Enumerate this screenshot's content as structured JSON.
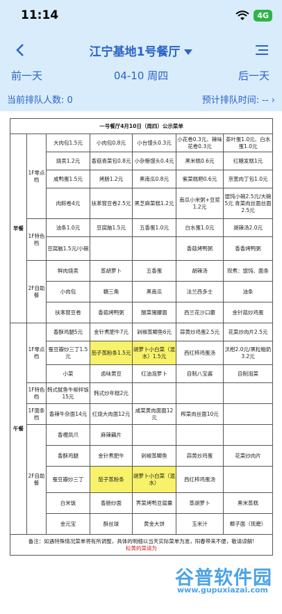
{
  "status": {
    "time": "11:14",
    "network": "4G"
  },
  "nav": {
    "title": "江宁基地1号餐厅"
  },
  "dates": {
    "prev": "前一天",
    "current": "04-10 周四",
    "next": "后一天"
  },
  "queue": {
    "current_label": "当前排队人数: 0",
    "expected_label": "预计排队时间: --"
  },
  "menu": {
    "title": "一号餐厅4月10日（周四）公示菜单",
    "breakfast": {
      "label": "早餐",
      "snack_label": "1F零点档",
      "snack_rows": [
        [
          "大肉包1.5元",
          "小肉包0.8元",
          "小台馒头0.3元",
          "小花卷0.3元、辣味花卷0.3元",
          "茶叶蛋1.0元、白水蛋1.0元"
        ],
        [
          "烧卖1.2元",
          "香菇青菜包0.8元",
          "小杂粮馒头0.4元",
          "黑米糕0.6元",
          "红糖发糕1元"
        ],
        [
          "咸鸭蛋1.5元",
          "烤肠1.2元",
          "黑南瓜0.8元",
          "紫菜糕粑0.6元",
          "京葱肉丁包1.0元"
        ],
        [
          "肉粽卷4元",
          "扶苯窗豆卷2.5元",
          "黑芝麻菜糕1.2元",
          "南瓜小米粥+豆浆1.2元",
          "馄饨小碗2.5元/大碗5元 青菜肉丝面丝面2.5元"
        ]
      ],
      "special_label": "1F特色档",
      "special_rows": [
        [
          "油条1.0元",
          "豆腐脑1.5元",
          "五香蛋1.0元",
          "白水蛋1.0元",
          "胡辣汤2.0元"
        ],
        [
          "豆腐脑1.5元/小碗",
          "",
          "",
          "香菇烤鸭粥",
          "香香烤鸭粥"
        ]
      ],
      "buffet_label": "2F自助餐",
      "buffet_rows": [
        [
          "鲜肉烧卖",
          "蒸胡萝卜",
          "五香蛋",
          "胡辣汤",
          "现煮：馄饨、面条"
        ],
        [
          "小肉包",
          "糖三角",
          "黑南瓜",
          "法兰西多士",
          "油条"
        ],
        [
          "扶苯窗豆卷",
          "香菇烤鸭粥",
          "酸菜猪腰面",
          "西兰花沙口蘑",
          "金针菇炒鸡蛋"
        ]
      ]
    },
    "lunch": {
      "label": "午餐",
      "snack_label": "1F零点档",
      "snack_rows": [
        [
          "香酥鸡腿5元",
          "金针煮肥牛7元",
          "剁椒蒸鲫鱼6元",
          "蒜黄炒鸡蛋2.5元",
          "花菜炒肉片2.5元"
        ],
        [
          "蚕豆瓣炒三丁1.5元",
          "茄子蒸粉条1.5元",
          "胡萝卜小白菜（混水）1.5元",
          "西红柿鸡蛋汤",
          "沃柑2.0元/黑粒糍奶3.2元"
        ],
        [
          "小菜",
          "卤味黄豆",
          "红油泡萝卜",
          "自制八宝酱",
          "自制泡菜"
        ]
      ],
      "special_label": "1F特色档",
      "special_rows": [
        [
          "韩式鱿鱼牛柳拌饭15元",
          "韩式炒年糕2元",
          "",
          "",
          ""
        ]
      ],
      "noodle_label": "1F面条档",
      "noodle_rows": [
        [
          "香辣牛杂面14元",
          "红烧大肉面12元",
          "咸菜黄肉面面12元",
          "榨菜肉丝面10元",
          ""
        ]
      ],
      "buffet_label": "2F自助餐",
      "buffet_rows": [
        [
          "香槽凤爪",
          "麻辣藕片",
          "",
          "",
          ""
        ],
        [
          "香酥鸡腿",
          "金针煮肥牛",
          "剁椒蒸鲫鱼",
          "蒜黄炒鸡蛋",
          "花菜炒肉片"
        ],
        [
          "蚕豆瓣炒三丁",
          "茄子蒸粉条",
          "胡萝卜小白菜（混水）",
          "西红柿鸡蛋汤",
          ""
        ],
        [
          "白米饭",
          "香肠炒面",
          "荠菜烤鸭豆腐羹",
          "蒸胡萝卜",
          "黑米蒸糕"
        ],
        [
          "金元宝",
          "酥丝球",
          "黄金大饼",
          "玉米汁",
          "椰子面（现磨）"
        ]
      ]
    },
    "note": "备注：如遇特殊情况菜单将有所调整，具体的明细以当天实际菜单为准，阳春带来不便，敬请谅解!",
    "note_red": "标黄的菜请为"
  },
  "watermark": {
    "title": "谷普软件园",
    "url": "www.gupuxiazai.com"
  },
  "colors": {
    "accent": "#2a63c8",
    "header_bg": "#d9ecfb",
    "highlight": "#f8f26a"
  }
}
